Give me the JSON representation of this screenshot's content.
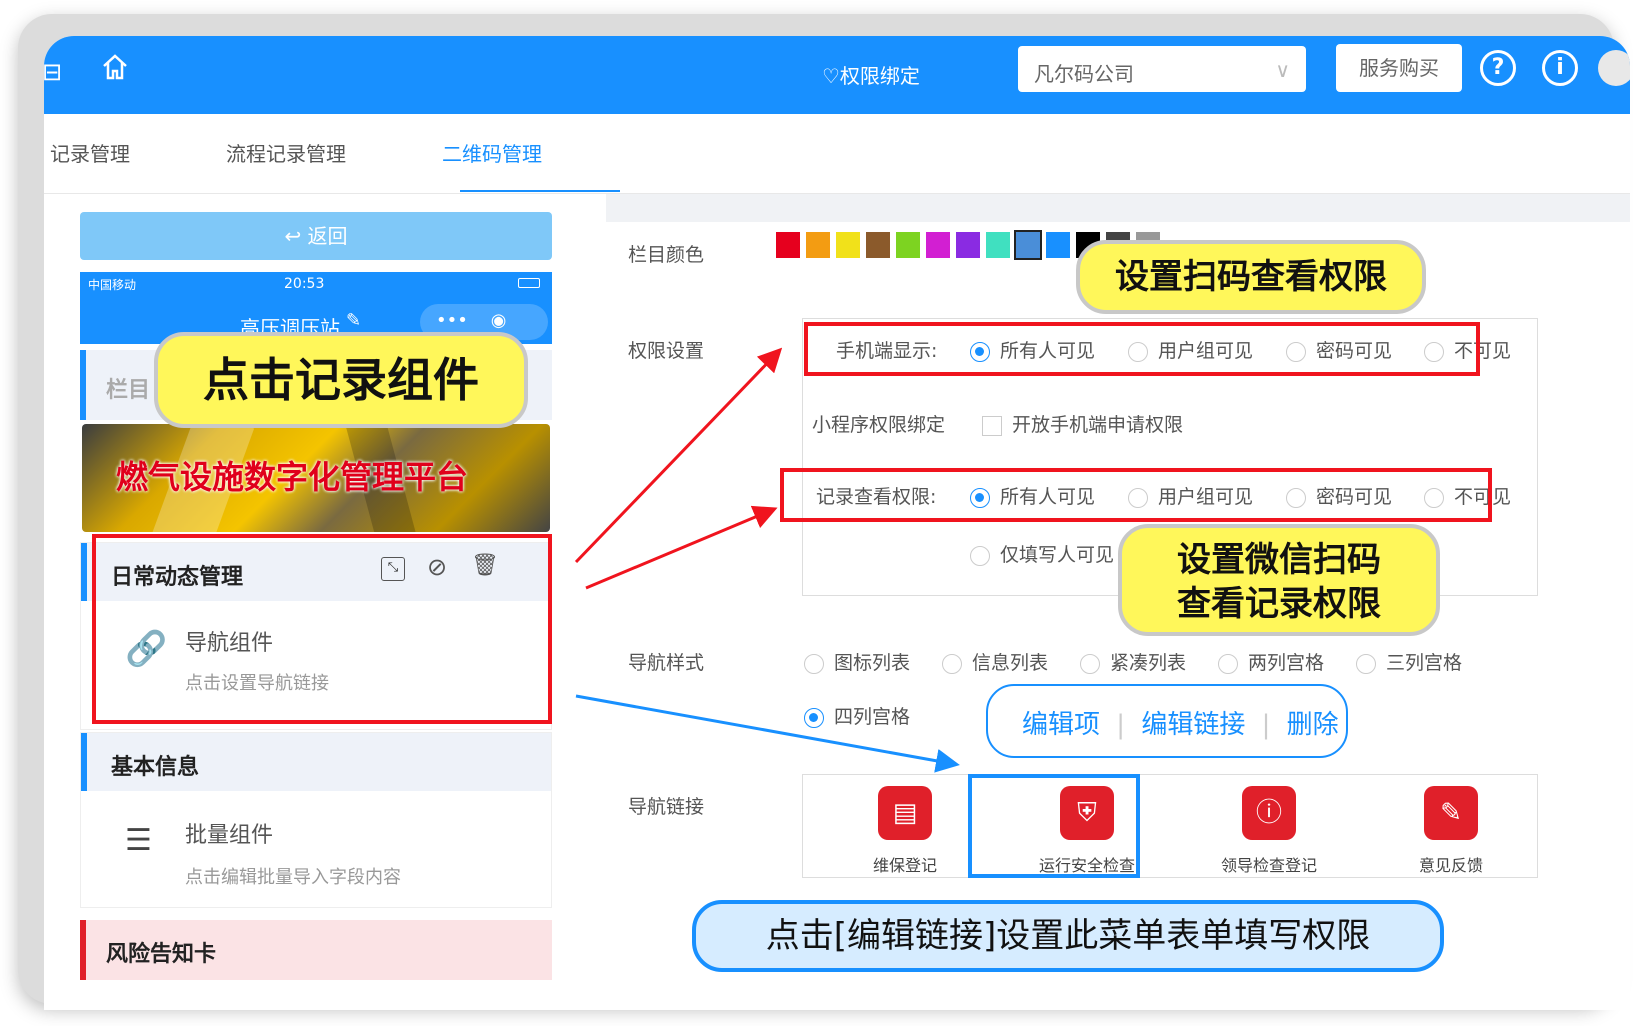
{
  "topbar": {
    "binding": "♡权限绑定",
    "company": "凡尔码公司",
    "buy": "服务购买"
  },
  "tabs": [
    "记录管理",
    "流程记录管理",
    "二维码管理"
  ],
  "left": {
    "back": "↩ 返回",
    "carrier": "中国移动",
    "time": "20:53",
    "station": "高压调压站",
    "col_partial": "栏目",
    "banner_text": "燃气设施数字化管理平台",
    "card1_title": "日常动态管理",
    "card1_item": "导航组件",
    "card1_sub": "点击设置导航链接",
    "card2_title": "基本信息",
    "card2_item": "批量组件",
    "card2_sub": "点击编辑批量导入字段内容",
    "card3_title": "风险告知卡"
  },
  "right": {
    "col_color": "栏目颜色",
    "perm": "权限设置",
    "mobile_label": "手机端显示:",
    "options": [
      "所有人可见",
      "用户组可见",
      "密码可见",
      "不可见"
    ],
    "mini_bind": "小程序权限绑定",
    "mini_open": "开放手机端申请权限",
    "record_label": "记录查看权限:",
    "only_writer": "仅填写人可见",
    "nav_style": "导航样式",
    "nav_styles": [
      "图标列表",
      "信息列表",
      "紧凑列表",
      "两列宫格",
      "三列宫格",
      "四列宫格"
    ],
    "edit_item": "编辑项",
    "edit_link": "编辑链接",
    "delete": "删除",
    "nav_links": "导航链接",
    "nav_items": [
      "维保登记",
      "运行安全检查",
      "领导检查登记",
      "意见反馈"
    ]
  },
  "callouts": {
    "click_record": "点击记录组件",
    "scan_perm": "设置扫码查看权限",
    "wechat_line1": "设置微信扫码",
    "wechat_line2": "查看记录权限",
    "bottom": "点击[编辑链接]设置此菜单表单填写权限"
  },
  "colors": {
    "accent": "#1890ff",
    "red": "#f0141e",
    "yellow": "#fff75a",
    "swatches": [
      "#e6001e",
      "#f39c12",
      "#f1e11a",
      "#8b5a2b",
      "#7dd321",
      "#d21fd2",
      "#8a2be2",
      "#40e0c0",
      "#4a8ed8",
      "#1890ff",
      "#000000",
      "#444444",
      "#999999",
      "#ffffff"
    ]
  }
}
